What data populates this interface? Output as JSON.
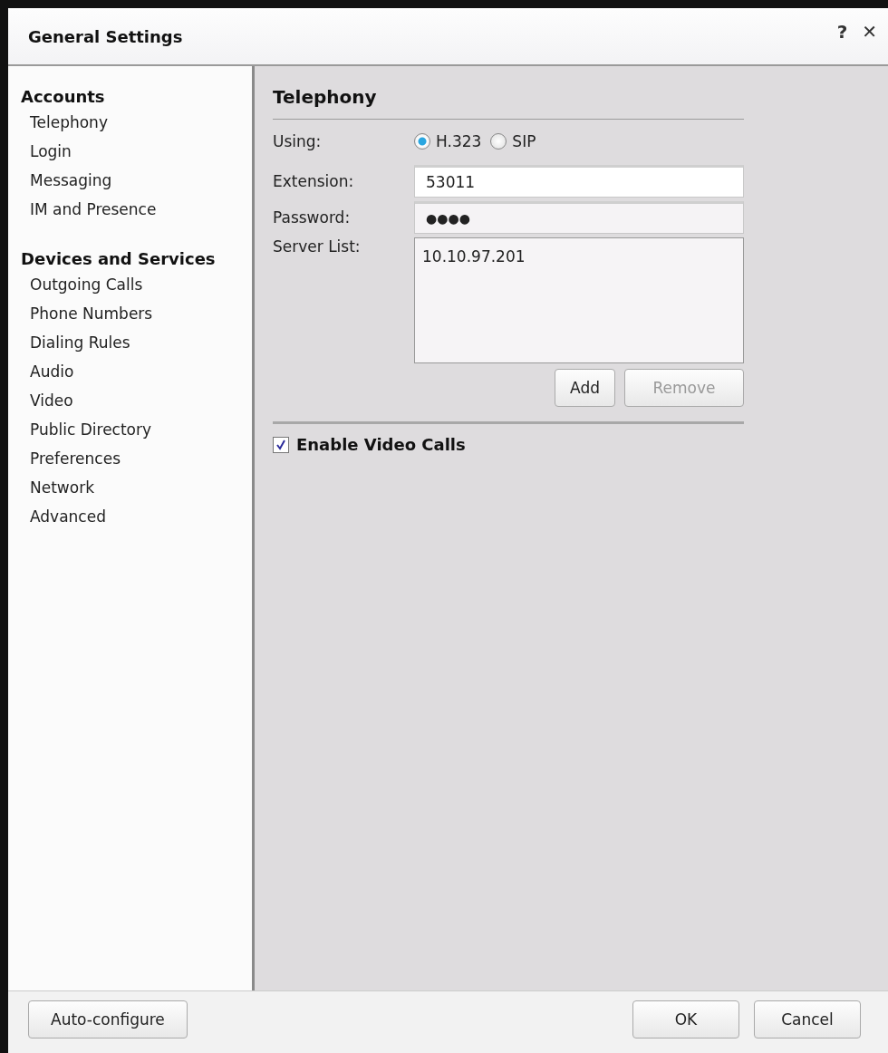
{
  "window": {
    "title": "General Settings",
    "help": "?",
    "close": "✕"
  },
  "sidebar": {
    "groups": [
      {
        "heading": "Accounts",
        "items": [
          "Telephony",
          "Login",
          "Messaging",
          "IM and Presence"
        ]
      },
      {
        "heading": "Devices and Services",
        "items": [
          "Outgoing Calls",
          "Phone Numbers",
          "Dialing Rules",
          "Audio",
          "Video",
          "Public Directory",
          "Preferences",
          "Network",
          "Advanced"
        ]
      }
    ]
  },
  "panel": {
    "title": "Telephony",
    "using": {
      "label": "Using:",
      "options": [
        {
          "label": "H.323",
          "selected": true
        },
        {
          "label": "SIP",
          "selected": false
        }
      ]
    },
    "extension": {
      "label": "Extension:",
      "value": "53011"
    },
    "password": {
      "label": "Password:",
      "value": "●●●●"
    },
    "server_list": {
      "label": "Server List:",
      "items": [
        "10.10.97.201"
      ]
    },
    "buttons": [
      {
        "label": "Add",
        "disabled": false
      },
      {
        "label": "Remove",
        "disabled": true
      }
    ],
    "enable_video": {
      "label": "Enable Video Calls",
      "checked": true
    }
  },
  "footer": {
    "left_button": "Auto-configure",
    "buttons": [
      "OK",
      "Cancel"
    ]
  }
}
